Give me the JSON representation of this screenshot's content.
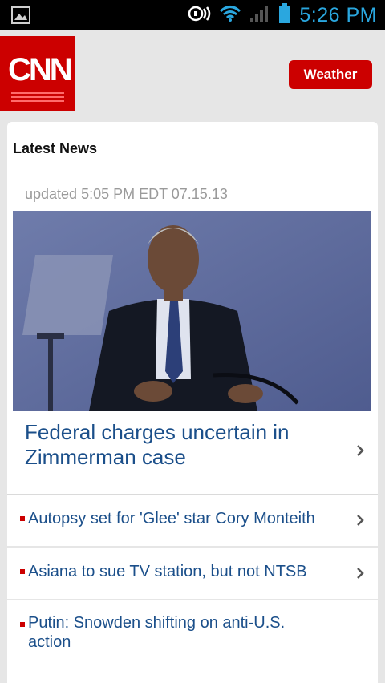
{
  "status_bar": {
    "time": "5:26 PM",
    "icons": [
      "image-icon",
      "nfc-icon",
      "wifi-icon",
      "signal-icon",
      "battery-icon"
    ]
  },
  "header": {
    "logo_text": "CNN",
    "weather_label": "Weather",
    "brand_color": "#cc0000"
  },
  "main": {
    "section_title": "Latest News",
    "updated": "updated 5:05 PM EDT 07.15.13",
    "top_story": {
      "headline": "Federal charges uncertain in Zimmerman case"
    },
    "stories": [
      {
        "title": "Autopsy set for 'Glee' star Cory Monteith"
      },
      {
        "title": "Asiana to sue TV station, but not NTSB"
      },
      {
        "title": "Putin: Snowden shifting on anti-U.S. action"
      }
    ]
  }
}
